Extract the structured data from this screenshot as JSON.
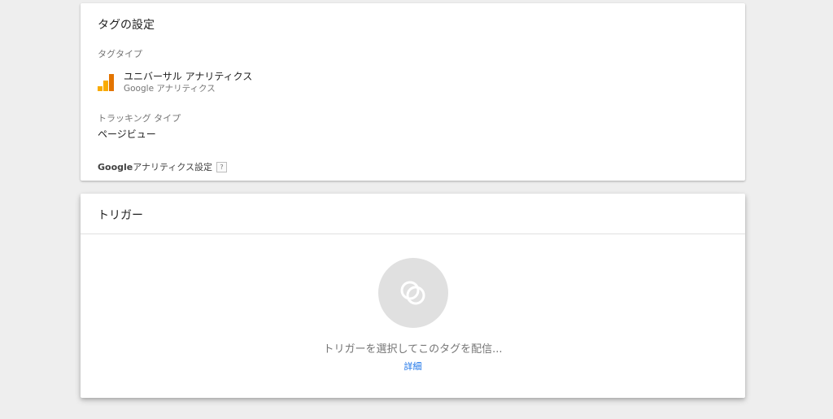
{
  "tag_config": {
    "title": "タグの設定",
    "tag_type_label": "タグタイプ",
    "tag_type_name": "ユニバーサル アナリティクス",
    "tag_type_sub": "Google アナリティクス",
    "tracking_type_label": "トラッキング タイプ",
    "tracking_type_value": "ページビュー",
    "ga_settings_strong": "Google",
    "ga_settings_rest": " アナリティクス設定",
    "help_glyph": "?"
  },
  "trigger": {
    "title": "トリガー",
    "prompt": "トリガーを選択してこのタグを配信...",
    "details_link": "詳細"
  },
  "colors": {
    "ga_yellow": "#F9AB00",
    "ga_orange": "#E37400",
    "link_blue": "#1a73e8"
  },
  "icons": {
    "tag_type_icon": "google-analytics-icon",
    "trigger_icon": "trigger-circles-icon",
    "help_icon": "help-icon"
  }
}
